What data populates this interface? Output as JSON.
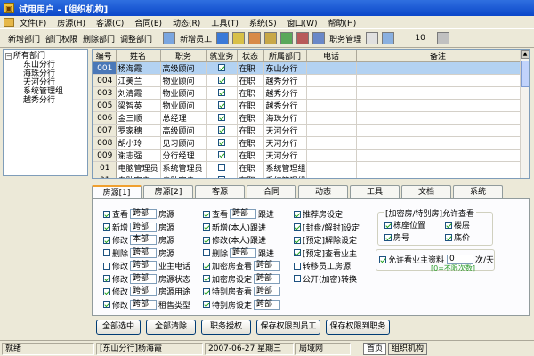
{
  "window": {
    "title": "试用用户 - [组织机构]"
  },
  "menu": [
    "文件(F)",
    "房源(H)",
    "客源(C)",
    "合同(E)",
    "动态(R)",
    "工具(T)",
    "系统(S)",
    "窗口(W)",
    "帮助(H)"
  ],
  "toolbar": {
    "add_dept": "新增部门",
    "dept_perm": "部门权限",
    "del_dept": "删除部门",
    "adjust_dept": "调整部门",
    "add_staff": "新增员工",
    "role_mgmt": "职务管理",
    "zoom": "10"
  },
  "tree": {
    "root": "所有部门",
    "children": [
      "东山分行",
      "海珠分行",
      "天河分行",
      "系统管理组",
      "越秀分行"
    ]
  },
  "grid": {
    "columns": [
      "编号",
      "姓名",
      "职务",
      "就业务",
      "状态",
      "所属部门",
      "电话",
      "备注"
    ],
    "rows": [
      {
        "id": "001",
        "name": "杨海霞",
        "title": "高级顾问",
        "biz": true,
        "status": "在职",
        "dept": "东山分行",
        "phone": "",
        "note": ""
      },
      {
        "id": "004",
        "name": "江美兰",
        "title": "物业顾问",
        "biz": true,
        "status": "在职",
        "dept": "越秀分行",
        "phone": "",
        "note": ""
      },
      {
        "id": "003",
        "name": "刘清霞",
        "title": "物业顾问",
        "biz": true,
        "status": "在职",
        "dept": "越秀分行",
        "phone": "",
        "note": ""
      },
      {
        "id": "005",
        "name": "梁智英",
        "title": "物业顾问",
        "biz": true,
        "status": "在职",
        "dept": "越秀分行",
        "phone": "",
        "note": ""
      },
      {
        "id": "006",
        "name": "金三顺",
        "title": "总经理",
        "biz": true,
        "status": "在职",
        "dept": "海珠分行",
        "phone": "",
        "note": ""
      },
      {
        "id": "007",
        "name": "罗家穗",
        "title": "高级顾问",
        "biz": true,
        "status": "在职",
        "dept": "天河分行",
        "phone": "",
        "note": ""
      },
      {
        "id": "008",
        "name": "胡小玲",
        "title": "见习顾问",
        "biz": true,
        "status": "在职",
        "dept": "天河分行",
        "phone": "",
        "note": ""
      },
      {
        "id": "009",
        "name": "谢志强",
        "title": "分行经理",
        "biz": true,
        "status": "在职",
        "dept": "天河分行",
        "phone": "",
        "note": ""
      },
      {
        "id": "01",
        "name": "电脑管理员",
        "title": "系统管理员",
        "biz": false,
        "status": "在职",
        "dept": "系统管理组",
        "phone": "",
        "note": ""
      },
      {
        "id": "01",
        "name": "自助客户",
        "title": "自助客户",
        "biz": false,
        "status": "在职",
        "dept": "系统管理组",
        "phone": "",
        "note": ""
      }
    ]
  },
  "tabs": [
    "房源[1]",
    "房源[2]",
    "客源",
    "合同",
    "动态",
    "工具",
    "文档",
    "系统"
  ],
  "perm": {
    "col1": [
      {
        "on": true,
        "label": "查看",
        "scope": "跨部",
        "obj": "房源"
      },
      {
        "on": true,
        "label": "新增",
        "scope": "跨部",
        "obj": "房源"
      },
      {
        "on": true,
        "label": "修改",
        "scope": "本部",
        "obj": "房源"
      },
      {
        "on": false,
        "label": "删除",
        "scope": "跨部",
        "obj": "房源"
      },
      {
        "on": false,
        "label": "修改",
        "scope": "跨部",
        "obj": "业主电话"
      },
      {
        "on": true,
        "label": "修改",
        "scope": "跨部",
        "obj": "房源状态"
      },
      {
        "on": true,
        "label": "修改",
        "scope": "跨部",
        "obj": "房源用途"
      },
      {
        "on": true,
        "label": "修改",
        "scope": "跨部",
        "obj": "租售类型"
      }
    ],
    "col2": [
      {
        "on": true,
        "label": "查看",
        "scope": "跨部",
        "obj": "跟进"
      },
      {
        "on": true,
        "label": "新增(本人)跟进"
      },
      {
        "on": true,
        "label": "修改(本人)跟进"
      },
      {
        "on": false,
        "label": "删除",
        "scope": "跨部",
        "obj": "跟进"
      },
      {
        "on": true,
        "label": "加密房查看",
        "scope": "跨部"
      },
      {
        "on": true,
        "label": "加密房设定",
        "scope": "跨部"
      },
      {
        "on": true,
        "label": "特别房查看",
        "scope": "跨部"
      },
      {
        "on": true,
        "label": "特别房设定",
        "scope": "跨部"
      }
    ],
    "col3": [
      {
        "on": true,
        "label": "推荐房设定"
      },
      {
        "on": true,
        "label": "[封盘/解封]设定"
      },
      {
        "on": true,
        "label": "[预定]解除设定"
      },
      {
        "on": true,
        "label": "[预定]查看业主"
      },
      {
        "on": false,
        "label": "转移员工房源"
      },
      {
        "on": false,
        "label": "公开(加密)转换"
      }
    ],
    "group_title": "[加密房/特别房]允许查看",
    "group_items": [
      {
        "on": true,
        "label": "栋座位置"
      },
      {
        "on": true,
        "label": "楼层"
      },
      {
        "on": true,
        "label": "房号"
      },
      {
        "on": true,
        "label": "底价"
      }
    ],
    "owner_view": {
      "on": true,
      "label": "允许看业主资料",
      "value": "0",
      "unit": "次/天"
    },
    "hint": "[0=不限次数]"
  },
  "buttons": [
    "全部选中",
    "全部清除",
    "职务授权",
    "保存权限到员工",
    "保存权限到职务"
  ],
  "status": {
    "state": "就绪",
    "user": "[东山分行]杨海霞",
    "date": "2007-06-27 星期三",
    "network": "局域网",
    "tab_home": "首页",
    "tab_org": "组织机构"
  }
}
